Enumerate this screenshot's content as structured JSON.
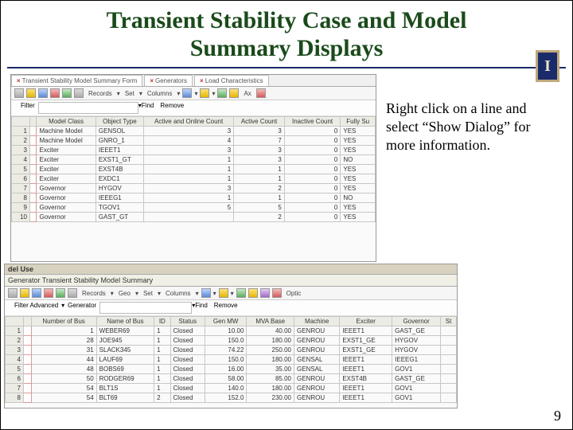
{
  "title_line1": "Transient Stability Case and Model",
  "title_line2": "Summary Displays",
  "logo_text": "I",
  "annotation": "Right click on a line and select “Show Dialog” for more information.",
  "page_number": "9",
  "shot1": {
    "tabs": [
      "Transient Stability Model Summary Form",
      "Generators",
      "Load Characteristics"
    ],
    "tb_records": "Records",
    "tb_set": "Set",
    "tb_columns": "Columns",
    "tb_ax": "Ax",
    "filter_label": "Filter",
    "find": "Find",
    "remove": "Remove",
    "headers": [
      "Model Class",
      "Object Type",
      "Active and Online Count",
      "Active Count",
      "Inactive Count",
      "Fully Su"
    ],
    "rows": [
      [
        "1",
        "",
        "Machine Model",
        "GENSOL",
        "3",
        "3",
        "0",
        "YES"
      ],
      [
        "2",
        "",
        "Machine Model",
        "GNRO_1",
        "4",
        "7",
        "0",
        "YES"
      ],
      [
        "3",
        "",
        "Exciter",
        "IEEET1",
        "3",
        "3",
        "0",
        "YES"
      ],
      [
        "4",
        "",
        "Exciter",
        "EXST1_GT",
        "1",
        "3",
        "0",
        "NO"
      ],
      [
        "5",
        "",
        "Exciter",
        "EXST4B",
        "1",
        "1",
        "0",
        "YES"
      ],
      [
        "6",
        "",
        "Exciter",
        "EXDC1",
        "1",
        "1",
        "0",
        "YES"
      ],
      [
        "7",
        "",
        "Governor",
        "HYGOV",
        "3",
        "2",
        "0",
        "YES"
      ],
      [
        "8",
        "",
        "Governor",
        "IEEEG1",
        "1",
        "1",
        "0",
        "NO"
      ],
      [
        "9",
        "",
        "Governor",
        "TGOV1",
        "5",
        "5",
        "0",
        "YES"
      ],
      [
        "10",
        "",
        "Governor",
        "GAST_GT",
        "",
        "2",
        "0",
        "YES"
      ]
    ]
  },
  "shot2": {
    "del_use": "del Use",
    "subtitle": "Generator Transient Stability Model Summary",
    "tb_records": "Records",
    "tb_geo": "Geo",
    "tb_set": "Set",
    "tb_columns": "Columns",
    "filter_label": "Filter  Advanced",
    "gen_label": "Generator",
    "find": "Find",
    "remove": "Remove",
    "optic": "Optic",
    "headers": [
      "Number of Bus",
      "Name of Bus",
      "ID",
      "Status",
      "Gen MW",
      "MVA Base",
      "Machine",
      "Exciter",
      "Governor",
      "St"
    ],
    "rows": [
      [
        "1",
        "",
        "1",
        "WEBER69",
        "1",
        "Closed",
        "10.00",
        "40.00",
        "GENROU",
        "IEEET1",
        "GAST_GE",
        ""
      ],
      [
        "2",
        "",
        "28",
        "JOE945",
        "1",
        "Closed",
        "150.0",
        "180.00",
        "GENROU",
        "EXST1_GE",
        "HYGOV",
        ""
      ],
      [
        "3",
        "",
        "31",
        "SLACK345",
        "1",
        "Closed",
        "74.22",
        "250.00",
        "GENROU",
        "EXST1_GE",
        "HYGOV",
        ""
      ],
      [
        "4",
        "",
        "44",
        "LAUF69",
        "1",
        "Closed",
        "150.0",
        "180.00",
        "GENSAL",
        "IEEET1",
        "IEEEG1",
        ""
      ],
      [
        "5",
        "",
        "48",
        "BOBS69",
        "1",
        "Closed",
        "16.00",
        "35.00",
        "GENSAL",
        "IEEET1",
        "GOV1",
        ""
      ],
      [
        "6",
        "",
        "50",
        "RODGER69",
        "1",
        "Closed",
        "58.00",
        "85.00",
        "GENROU",
        "EXST4B",
        "GAST_GE",
        ""
      ],
      [
        "7",
        "",
        "54",
        "BLT1S",
        "1",
        "Closed",
        "140.0",
        "180.00",
        "GENROU",
        "IEEET1",
        "GOV1",
        ""
      ],
      [
        "8",
        "",
        "54",
        "BLT69",
        "2",
        "Closed",
        "152.0",
        "230.00",
        "GENROU",
        "IEEET1",
        "GOV1",
        ""
      ]
    ]
  }
}
